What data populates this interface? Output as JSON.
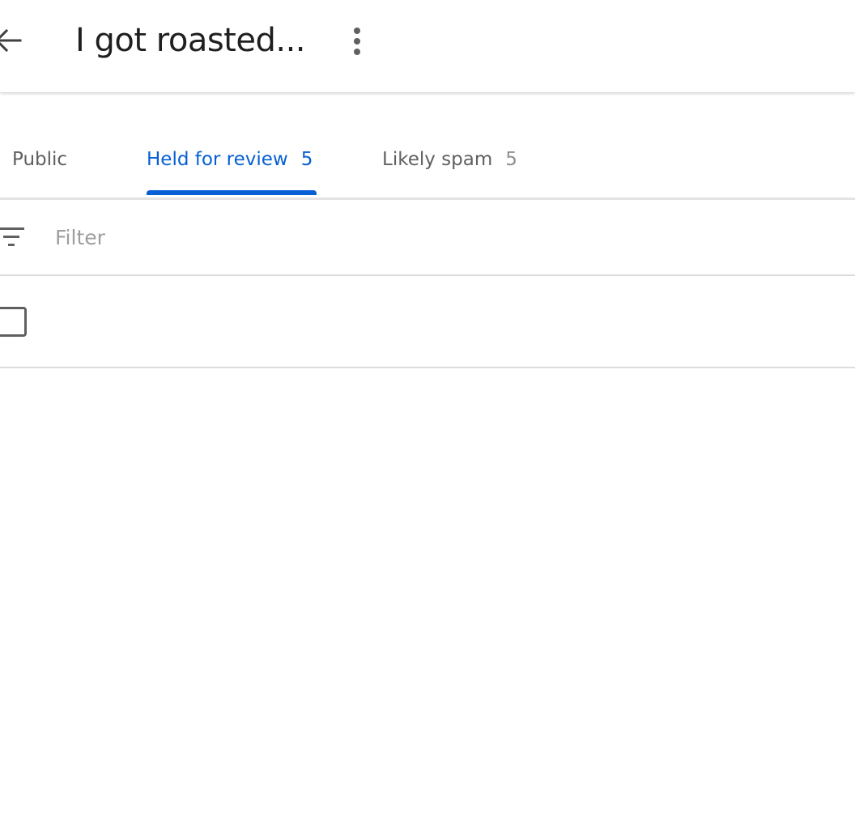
{
  "header": {
    "title": "I got roasted...",
    "back_icon": "arrow-left-icon",
    "more_icon": "more-vert-icon"
  },
  "tabs": [
    {
      "label": "Public",
      "count": ""
    },
    {
      "label": "Held for review",
      "count": "5",
      "active": true
    },
    {
      "label": "Likely spam",
      "count": "5"
    }
  ],
  "filter": {
    "icon": "filter-icon",
    "placeholder": "Filter",
    "value": ""
  },
  "select_all": {
    "checked": false
  },
  "colors": {
    "accent": "#065fd4",
    "text_primary": "#1f1f1f",
    "text_secondary": "#606060",
    "divider": "#dcdcdc"
  }
}
